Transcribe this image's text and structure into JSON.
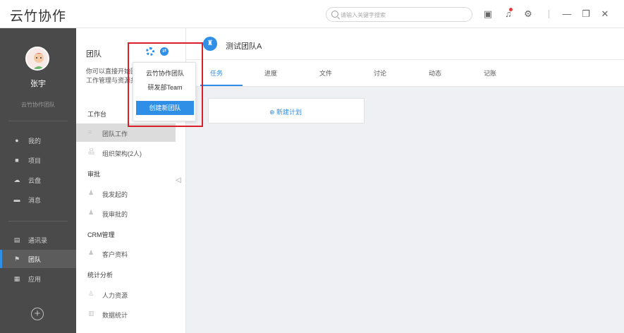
{
  "app": {
    "title": "云竹协作"
  },
  "search": {
    "placeholder": "请输入关键字搜索"
  },
  "user": {
    "name": "张宇",
    "team": "云竹协作团队"
  },
  "nav": {
    "top": [
      {
        "label": "我的",
        "icon": "person-icon"
      },
      {
        "label": "项目",
        "icon": "project-icon"
      },
      {
        "label": "云盘",
        "icon": "cloud-icon"
      },
      {
        "label": "消息",
        "icon": "message-icon"
      }
    ],
    "bottom": [
      {
        "label": "通讯录",
        "icon": "contacts-icon"
      },
      {
        "label": "团队",
        "icon": "flag-icon"
      },
      {
        "label": "应用",
        "icon": "apps-icon"
      }
    ]
  },
  "sidebar": {
    "title": "团队",
    "desc_line1": "你可以直接开始团",
    "desc_line2": "工作管理与资源共",
    "sections": {
      "workbench": "工作台",
      "approval": "审批",
      "crm": "CRM管理",
      "stats": "统计分析"
    },
    "items": {
      "team_work": "团队工作",
      "org": "组织架构(2人)",
      "initiated": "我发起的",
      "approved": "我审批的",
      "customers": "客户资料",
      "hr": "人力资源",
      "data_stats": "数据统计"
    }
  },
  "dropdown": {
    "teams": [
      "云竹协作团队",
      "研发部Team"
    ],
    "create_label": "创建新团队"
  },
  "main": {
    "team_name": "测试团队A",
    "tabs": [
      "任务",
      "进度",
      "文件",
      "讨论",
      "动态",
      "记账"
    ],
    "active_tab": "任务",
    "new_plan": "⊕ 新建计划"
  },
  "colors": {
    "accent": "#2f8ee6",
    "sidebar": "#4a4a4a",
    "highlight": "#d9202a"
  }
}
